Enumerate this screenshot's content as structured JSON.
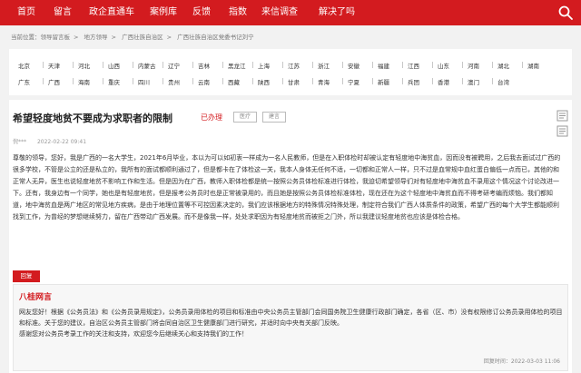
{
  "nav": {
    "items": [
      "首页",
      "留言",
      "政企直通车",
      "案例库",
      "反馈",
      "指数",
      "来信调查",
      "解决了吗"
    ]
  },
  "breadcrumb": [
    "当前位置：领导留言板",
    "地方领导",
    "广西壮族自治区",
    "广西壮族自治区党委书记刘宁"
  ],
  "regions": {
    "row1": [
      "北京",
      "天津",
      "河北",
      "山西",
      "内蒙古",
      "辽宁",
      "吉林",
      "黑龙江",
      "上海",
      "江苏",
      "浙江",
      "安徽",
      "福建",
      "江西",
      "山东",
      "河南",
      "湖北",
      "湖南"
    ],
    "row2": [
      "广东",
      "广西",
      "海南",
      "重庆",
      "四川",
      "贵州",
      "云南",
      "西藏",
      "陕西",
      "甘肃",
      "青海",
      "宁夏",
      "新疆",
      "兵团",
      "香港",
      "澳门",
      "台湾"
    ]
  },
  "message": {
    "title": "希望轻度地贫不要成为求职者的限制",
    "status": "已办理",
    "tags": [
      "医疗",
      "建言"
    ],
    "author": "倪***",
    "date": "2022-02-22 09:41",
    "paragraphs": [
      "尊敬的领导，您好，我是广西的一名大学生，2021年6月毕业，本以为可以如初衷一样成为一名人民教师，但是在入职体检时却被认定有轻度地中海贫血，因而没有被聘用，之后我去面试过广西的很多学校，不管是公立的还是私立的，我所有的面试都顺利通过了，但是都卡在了体检这一关，我本人身体无任何不适，一切都和正常人一样，只不过是血常规中血红蛋白偏低一点而已，其他的和正常人无异，医生也说轻度地贫不影响工作和生活。但是因为在广西，教师入职体检都是统一按照公务员体检标准进行体检，我迫切希望领导们对有轻度地中海贫血不录用这个情况这个讨论改进一下。还有，我身边有一个同学，她也是有轻度地贫，但是报考公务员时也是正常被录用的，而且她是按照公务员体检标准体检，现在还在为这个轻度地中海贫血而不得考研考编而烦恼。我们都知道，地中海贫血是两广地区的常见地方疾病，是由于地理位置等不可控因素决定的，我们应该根据地方的特殊情况特殊处理，制定符合我们广西人体质条件的政策，希望广西的每个大学生都能顺利找到工作，为曾经的梦想继续努力，留在广西带动广西发展。而不是像我一样，处处求职因为有轻度地贫而被拒之门外，所以我建议轻度地贫也应该是体检合格。"
    ]
  },
  "reply": {
    "badge": "回复",
    "from": "八桂网言",
    "lines": [
      "网友您好！根据《公务员法》和《公务员录用规定》，公务员录用体检的项目和标准由中央公务员主管部门会同国务院卫生健康行政部门确定，各省（区、市）没有权限修订公务员录用体检的项目和标准。关于您的建议，自治区公务员主管部门将会同自治区卫生健康部门进行研究，并适时向中央有关部门反映。",
      "感谢您对公务员考录工作的关注和支持，欢迎您今后继续关心和支持我们的工作！"
    ],
    "time_label": "回复时间：",
    "time": "2022-03-03 11:06"
  },
  "colors": {
    "brand": "#d31b1f"
  }
}
